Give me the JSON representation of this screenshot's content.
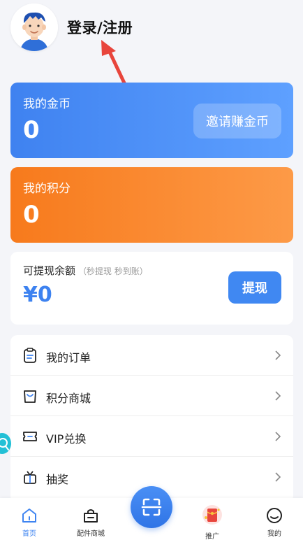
{
  "header": {
    "login_label": "登录/注册"
  },
  "coins": {
    "label": "我的金币",
    "value": "0",
    "invite_label": "邀请赚金币"
  },
  "points": {
    "label": "我的积分",
    "value": "0"
  },
  "withdraw": {
    "label": "可提现余额",
    "sub_label": "（秒提现 秒到账）",
    "amount": "¥0",
    "button_label": "提现"
  },
  "menu": {
    "items": [
      {
        "label": "我的订单",
        "icon": "clipboard-icon"
      },
      {
        "label": "积分商城",
        "icon": "shopping-bag-icon"
      },
      {
        "label": "VIP兑换",
        "icon": "ticket-icon"
      },
      {
        "label": "抽奖",
        "icon": "gift-icon"
      }
    ]
  },
  "tabbar": {
    "items": [
      {
        "label": "首页",
        "icon": "home-icon",
        "active": true
      },
      {
        "label": "配件商城",
        "icon": "shop-icon",
        "active": false
      },
      {
        "label": "推广",
        "icon": "red-envelope-icon",
        "active": false
      },
      {
        "label": "我的",
        "icon": "smiley-icon",
        "active": false
      }
    ],
    "scan_icon": "scan-icon"
  },
  "colors": {
    "coins_gradient": [
      "#3f82f0",
      "#5ea0ff"
    ],
    "points_gradient": [
      "#f77a1c",
      "#fd9a47"
    ],
    "accent_blue": "#3d82f0",
    "annotation_arrow": "#e8453c"
  }
}
